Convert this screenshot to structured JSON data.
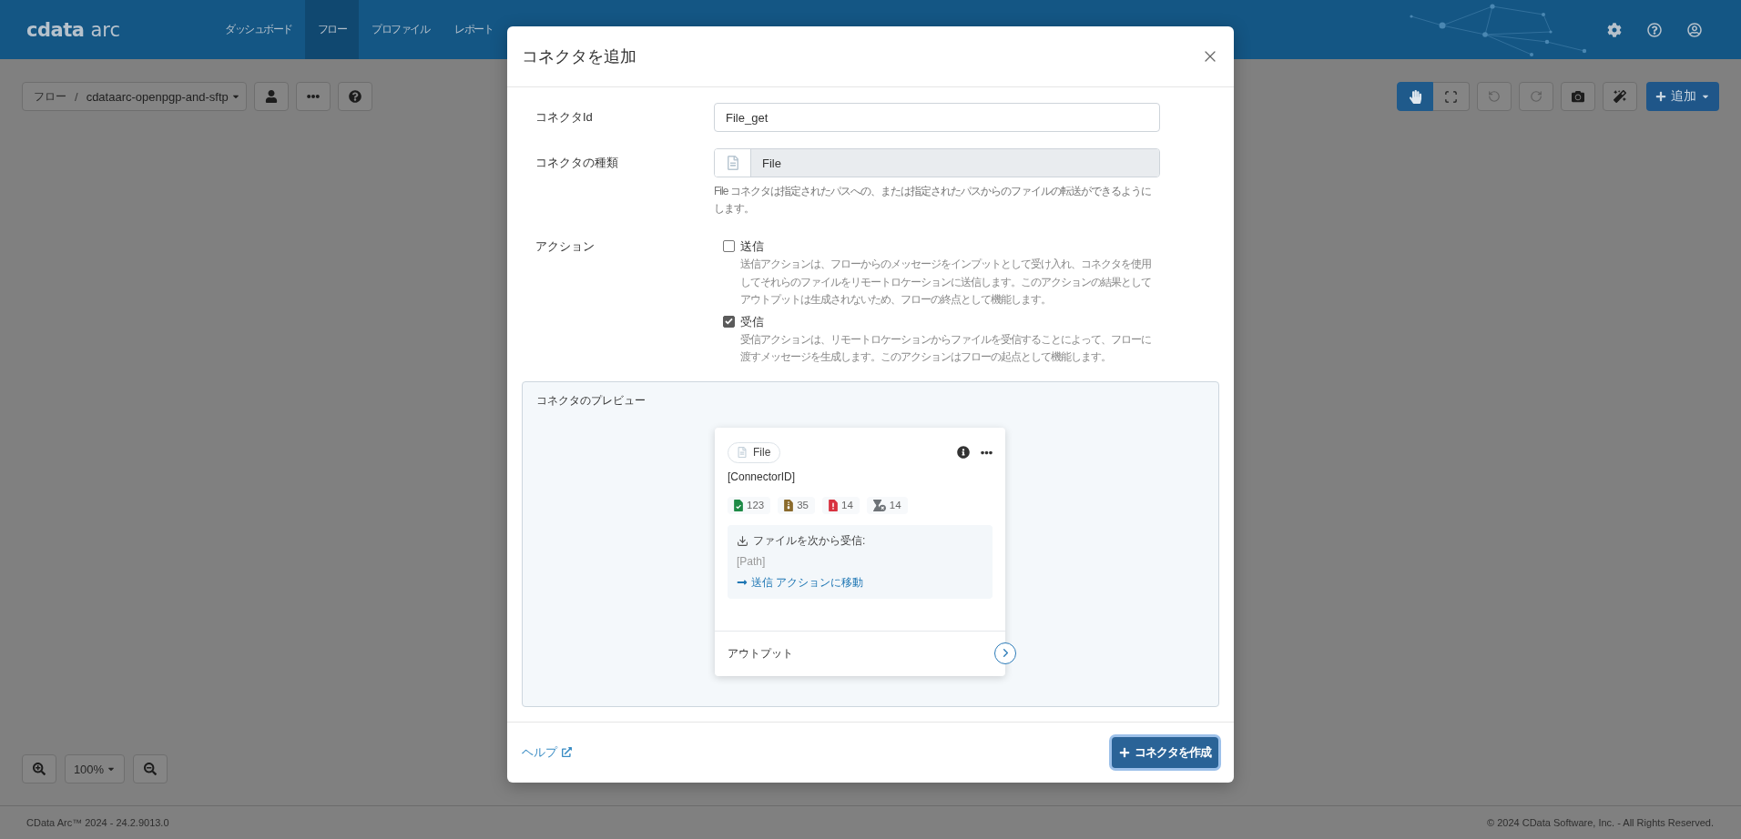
{
  "header": {
    "logo": {
      "brand": "cdata",
      "product": "arc"
    },
    "nav": [
      {
        "label": "ダッシュボード",
        "selected": false
      },
      {
        "label": "フロー",
        "selected": true
      },
      {
        "label": "プロファイル",
        "selected": false
      },
      {
        "label": "レポート",
        "selected": false
      }
    ],
    "icons": [
      {
        "kind": "settings"
      },
      {
        "kind": "help"
      },
      {
        "kind": "account"
      }
    ]
  },
  "toolbar": {
    "breadcrumb": {
      "root": "フロー",
      "separator": "/",
      "flow": "cdataarc-openpgp-and-sftp"
    },
    "flow_buttons": [
      {
        "kind": "user"
      },
      {
        "kind": "more"
      },
      {
        "kind": "help"
      }
    ],
    "modes": [
      {
        "kind": "pan",
        "selected": true
      },
      {
        "kind": "select",
        "selected": false
      }
    ],
    "tools": [
      {
        "kind": "undo",
        "disabled": true
      },
      {
        "kind": "redo",
        "disabled": true
      },
      {
        "kind": "snapshot",
        "disabled": false
      },
      {
        "kind": "auto_layout",
        "disabled": false
      }
    ],
    "add_button": "追加"
  },
  "zoom": {
    "value": "100%"
  },
  "status_bar": {
    "version": "CData Arc™ 2024 - 24.2.9013.0",
    "copyright": "© 2024 CData Software, Inc. - All Rights Reserved."
  },
  "modal": {
    "title": "コネクタを追加",
    "fields": [
      {
        "kind": "text",
        "label": "コネクタId",
        "value": "File_get"
      },
      {
        "kind": "type",
        "label": "コネクタの種類",
        "value": "File",
        "help": "File コネクタは指定されたパスへの、または指定されたパスからのファイルの転送ができるようにします。"
      }
    ],
    "actions": {
      "label": "アクション",
      "options": [
        {
          "label": "送信",
          "checked": false,
          "description": "送信アクションは、フローからのメッセージをインプットとして受け入れ、コネクタを使用してそれらのファイルをリモートロケーションに送信します。このアクションの結果としてアウトプットは生成されないため、フローの終点として機能します。"
        },
        {
          "label": "受信",
          "checked": true,
          "description": "受信アクションは、リモートロケーションからファイルを受信することによって、フローに渡すメッセージを生成します。このアクションはフローの起点として機能します。"
        }
      ]
    },
    "preview": {
      "title": "コネクタのプレビュー",
      "card": {
        "type_badge": "File",
        "connector_id": "[ConnectorID]",
        "stats": [
          {
            "kind": "success",
            "color": "#1e8a46",
            "count": "123"
          },
          {
            "kind": "pending",
            "color": "#8a6a2c",
            "count": "35"
          },
          {
            "kind": "error",
            "color": "#d8313f",
            "count": "14"
          },
          {
            "kind": "queued",
            "color": "#6d7277",
            "count": "14"
          }
        ],
        "receive": {
          "heading": "ファイルを次から受信:",
          "path": "[Path]",
          "link": "送信 アクションに移動"
        },
        "output_label": "アウトプット"
      }
    },
    "footer": {
      "help_link": "ヘルプ",
      "create_button": "コネクタを作成"
    }
  }
}
